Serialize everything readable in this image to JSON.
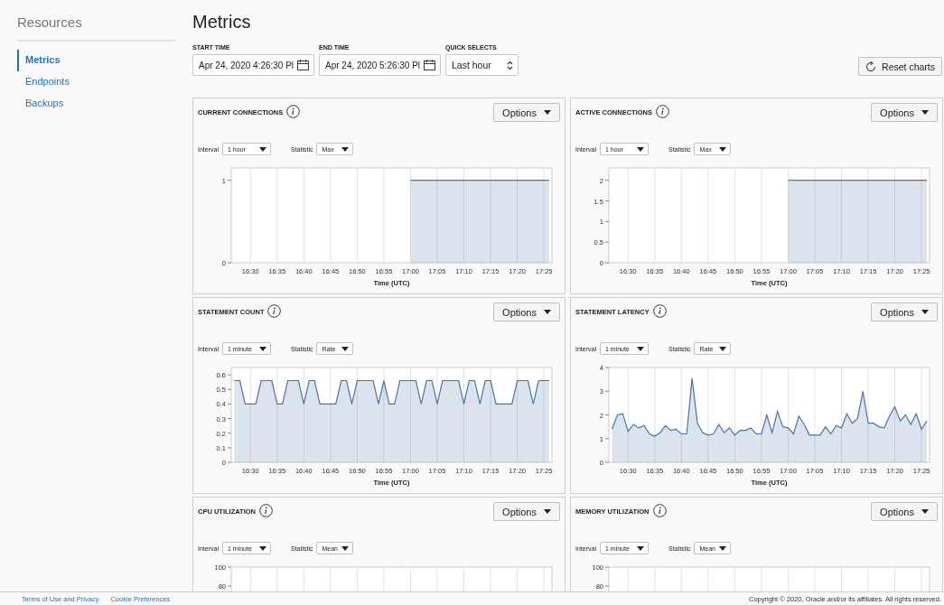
{
  "sidebar": {
    "title": "Resources",
    "items": [
      {
        "label": "Metrics",
        "selected": true
      },
      {
        "label": "Endpoints",
        "selected": false
      },
      {
        "label": "Backups",
        "selected": false
      }
    ]
  },
  "page_title": "Metrics",
  "filters": {
    "start_time": {
      "label": "START TIME",
      "value": "Apr 24, 2020 4:26:30 Pl"
    },
    "end_time": {
      "label": "END TIME",
      "value": "Apr 24, 2020 5:26:30 Pl"
    },
    "quick_selects": {
      "label": "QUICK SELECTS",
      "value": "Last hour"
    }
  },
  "reset_button": "Reset charts",
  "panels": [
    {
      "title": "CURRENT CONNECTIONS",
      "options": "Options",
      "interval": {
        "label": "Interval",
        "value": "1 hour"
      },
      "statistic": {
        "label": "Statistic",
        "value": "Max"
      },
      "chart_data": {
        "type": "area",
        "grid": true,
        "xlabel": "Time (UTC)",
        "ylim": [
          0,
          1.15
        ],
        "yticks": [
          0,
          1
        ],
        "categories": [
          null,
          null,
          null,
          "16:30",
          null,
          null,
          null,
          null,
          "16:35",
          null,
          null,
          null,
          null,
          "16:40",
          null,
          null,
          null,
          null,
          "16:45",
          null,
          null,
          null,
          null,
          "16:50",
          null,
          null,
          null,
          null,
          "16:55",
          null,
          null,
          null,
          null,
          "17:00",
          null,
          null,
          null,
          null,
          "17:05",
          null,
          null,
          null,
          null,
          "17:10",
          null,
          null,
          null,
          null,
          "17:15",
          null,
          null,
          null,
          null,
          "17:20",
          null,
          null,
          null,
          null,
          "17:25",
          null
        ],
        "series": [
          {
            "color": "#4a74a6",
            "values": [
              null,
              null,
              null,
              null,
              null,
              null,
              null,
              null,
              null,
              null,
              null,
              null,
              null,
              null,
              null,
              null,
              null,
              null,
              null,
              null,
              null,
              null,
              null,
              null,
              null,
              null,
              null,
              null,
              null,
              null,
              null,
              null,
              null,
              1,
              1,
              1,
              1,
              1,
              1,
              1,
              1,
              1,
              1,
              1,
              1,
              1,
              1,
              1,
              1,
              1,
              1,
              1,
              1,
              1,
              1,
              1,
              1,
              1,
              1,
              1
            ]
          }
        ]
      }
    },
    {
      "title": "ACTIVE CONNECTIONS",
      "options": "Options",
      "interval": {
        "label": "Interval",
        "value": "1 hour"
      },
      "statistic": {
        "label": "Statistic",
        "value": "Max"
      },
      "chart_data": {
        "type": "area",
        "grid": true,
        "xlabel": "Time (UTC)",
        "ylim": [
          0,
          2.3
        ],
        "yticks": [
          0,
          0.5,
          1,
          1.5,
          2
        ],
        "categories": [
          null,
          null,
          null,
          "16:30",
          null,
          null,
          null,
          null,
          "16:35",
          null,
          null,
          null,
          null,
          "16:40",
          null,
          null,
          null,
          null,
          "16:45",
          null,
          null,
          null,
          null,
          "16:50",
          null,
          null,
          null,
          null,
          "16:55",
          null,
          null,
          null,
          null,
          "17:00",
          null,
          null,
          null,
          null,
          "17:05",
          null,
          null,
          null,
          null,
          "17:10",
          null,
          null,
          null,
          null,
          "17:15",
          null,
          null,
          null,
          null,
          "17:20",
          null,
          null,
          null,
          null,
          "17:25",
          null
        ],
        "series": [
          {
            "color": "#4a74a6",
            "values": [
              null,
              null,
              null,
              null,
              null,
              null,
              null,
              null,
              null,
              null,
              null,
              null,
              null,
              null,
              null,
              null,
              null,
              null,
              null,
              null,
              null,
              null,
              null,
              null,
              null,
              null,
              null,
              null,
              null,
              null,
              null,
              null,
              null,
              2,
              2,
              2,
              2,
              2,
              2,
              2,
              2,
              2,
              2,
              2,
              2,
              2,
              2,
              2,
              2,
              2,
              2,
              2,
              2,
              2,
              2,
              2,
              2,
              2,
              2,
              2
            ]
          }
        ]
      }
    },
    {
      "title": "STATEMENT COUNT",
      "options": "Options",
      "interval": {
        "label": "Interval",
        "value": "1 minute"
      },
      "statistic": {
        "label": "Statistic",
        "value": "Rate"
      },
      "chart_data": {
        "type": "area",
        "grid": true,
        "xlabel": "Time (UTC)",
        "ylim": [
          0,
          0.65
        ],
        "yticks": [
          0,
          0.1,
          0.2,
          0.3,
          0.4,
          0.5,
          0.6
        ],
        "categories": [
          null,
          null,
          null,
          "16:30",
          null,
          null,
          null,
          null,
          "16:35",
          null,
          null,
          null,
          null,
          "16:40",
          null,
          null,
          null,
          null,
          "16:45",
          null,
          null,
          null,
          null,
          "16:50",
          null,
          null,
          null,
          null,
          "16:55",
          null,
          null,
          null,
          null,
          "17:00",
          null,
          null,
          null,
          null,
          "17:05",
          null,
          null,
          null,
          null,
          "17:10",
          null,
          null,
          null,
          null,
          "17:15",
          null,
          null,
          null,
          null,
          "17:20",
          null,
          null,
          null,
          null,
          "17:25",
          null
        ],
        "series": [
          {
            "color": "#4a74a6",
            "values": [
              0.56,
              0.56,
              0.4,
              0.4,
              0.4,
              0.56,
              0.56,
              0.56,
              0.4,
              0.4,
              0.56,
              0.56,
              0.56,
              0.4,
              0.56,
              0.56,
              0.4,
              0.4,
              0.4,
              0.4,
              0.56,
              0.56,
              0.4,
              0.56,
              0.56,
              0.56,
              0.56,
              0.4,
              0.56,
              0.4,
              0.4,
              0.56,
              0.56,
              0.56,
              0.56,
              0.4,
              0.56,
              0.56,
              0.4,
              0.56,
              0.56,
              0.56,
              0.56,
              0.4,
              0.56,
              0.56,
              0.4,
              0.56,
              0.56,
              0.4,
              0.4,
              0.4,
              0.4,
              0.56,
              0.56,
              0.56,
              0.4,
              0.56,
              0.56,
              0.56
            ]
          }
        ]
      }
    },
    {
      "title": "STATEMENT LATENCY",
      "options": "Options",
      "interval": {
        "label": "Interval",
        "value": "1 minute"
      },
      "statistic": {
        "label": "Statistic",
        "value": "Rate"
      },
      "chart_data": {
        "type": "area",
        "grid": true,
        "xlabel": "Time (UTC)",
        "ylim": [
          0,
          4
        ],
        "yticks": [
          0,
          1,
          2,
          3,
          4
        ],
        "categories": [
          null,
          null,
          null,
          "16:30",
          null,
          null,
          null,
          null,
          "16:35",
          null,
          null,
          null,
          null,
          "16:40",
          null,
          null,
          null,
          null,
          "16:45",
          null,
          null,
          null,
          null,
          "16:50",
          null,
          null,
          null,
          null,
          "16:55",
          null,
          null,
          null,
          null,
          "17:00",
          null,
          null,
          null,
          null,
          "17:05",
          null,
          null,
          null,
          null,
          "17:10",
          null,
          null,
          null,
          null,
          "17:15",
          null,
          null,
          null,
          null,
          "17:20",
          null,
          null,
          null,
          null,
          "17:25",
          null
        ],
        "series": [
          {
            "color": "#4a74a6",
            "values": [
              1.4,
              2.0,
              2.05,
              1.3,
              1.6,
              1.45,
              1.55,
              1.2,
              1.1,
              1.25,
              1.55,
              1.35,
              1.4,
              1.2,
              1.2,
              3.55,
              1.65,
              1.25,
              1.15,
              1.2,
              1.6,
              1.25,
              1.45,
              1.15,
              1.35,
              1.35,
              1.45,
              1.2,
              1.2,
              2.0,
              1.25,
              2.15,
              1.5,
              1.45,
              1.2,
              1.95,
              1.6,
              1.15,
              1.15,
              1.15,
              1.5,
              1.2,
              1.55,
              1.45,
              2.05,
              1.65,
              1.85,
              3.0,
              1.65,
              1.65,
              1.5,
              1.45,
              1.95,
              2.35,
              1.75,
              2.0,
              1.6,
              2.05,
              1.4,
              1.75
            ]
          }
        ]
      }
    },
    {
      "title": "CPU UTILIZATION",
      "options": "Options",
      "interval": {
        "label": "Interval",
        "value": "1 minute"
      },
      "statistic": {
        "label": "Statistic",
        "value": "Mean"
      },
      "y_axis_labels": [
        "100",
        "80"
      ]
    },
    {
      "title": "MEMORY UTILIZATION",
      "options": "Options",
      "interval": {
        "label": "Interval",
        "value": "1 minute"
      },
      "statistic": {
        "label": "Statistic",
        "value": "Mean"
      },
      "y_axis_labels": [
        "100",
        "80"
      ]
    }
  ],
  "footer": {
    "links": [
      "Terms of Use and Privacy",
      "Cookie Preferences"
    ],
    "copyright": "Copyright © 2020, Oracle and/or its affiliates. All rights reserved."
  }
}
